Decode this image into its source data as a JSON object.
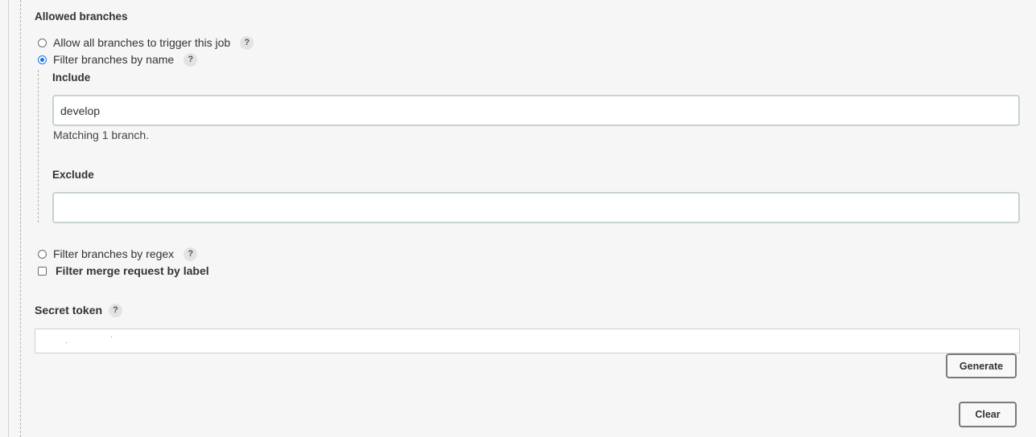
{
  "allowed_branches": {
    "title": "Allowed branches",
    "options": {
      "allow_all": {
        "label": "Allow all branches to trigger this job",
        "selected": false
      },
      "filter_by_name": {
        "label": "Filter branches by name",
        "selected": true
      },
      "filter_by_regex": {
        "label": "Filter branches by regex",
        "selected": false
      }
    },
    "help_glyph": "?",
    "include": {
      "label": "Include",
      "value": "develop",
      "hint": "Matching 1 branch."
    },
    "exclude": {
      "label": "Exclude",
      "value": ""
    },
    "merge_request_filter": {
      "label": "Filter merge request by label",
      "checked": false
    }
  },
  "secret_token": {
    "label": "Secret token",
    "generate_label": "Generate",
    "clear_label": "Clear"
  },
  "colors": {
    "background": "#f6f6f6",
    "accent": "#1a73e8",
    "input_border": "#c7d2d2"
  }
}
